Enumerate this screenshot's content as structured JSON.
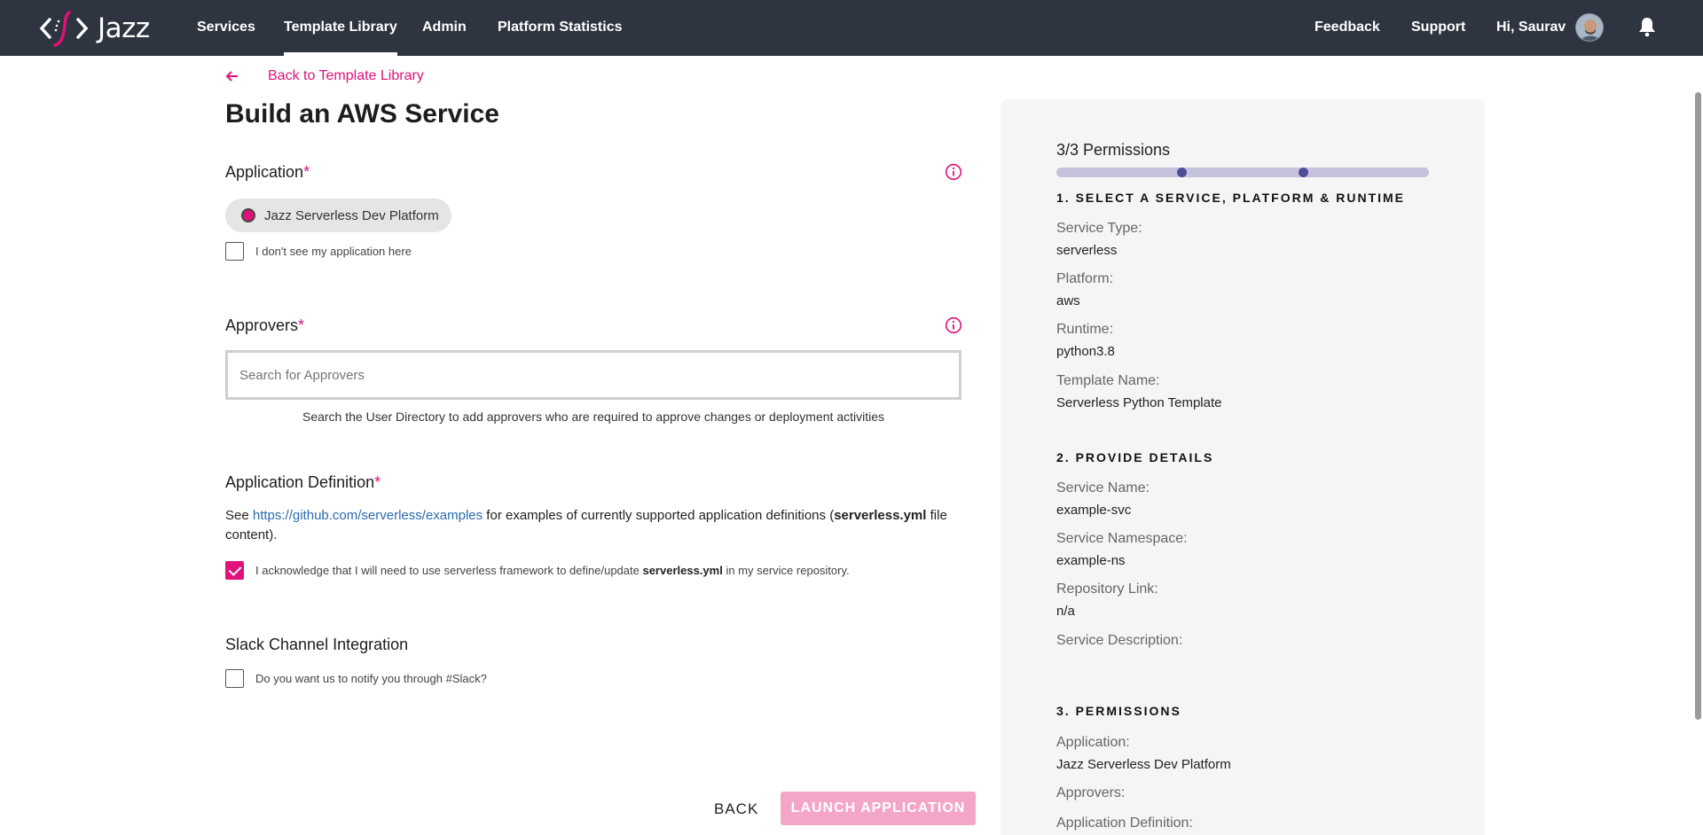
{
  "nav": {
    "brand": "Jazz",
    "items": [
      {
        "label": "Services"
      },
      {
        "label": "Template Library"
      },
      {
        "label": "Admin"
      },
      {
        "label": "Platform Statistics"
      }
    ],
    "feedback": "Feedback",
    "support": "Support",
    "greeting": "Hi, Saurav"
  },
  "page": {
    "back_link": "Back to Template Library",
    "title": "Build an AWS Service"
  },
  "application": {
    "label": "Application",
    "required": "*",
    "chip": "Jazz Serverless Dev Platform",
    "not_listed": "I don't see my application here"
  },
  "approvers": {
    "label": "Approvers",
    "required": "*",
    "placeholder": "Search for Approvers",
    "helper": "Search the User Directory to add approvers who are required to approve changes or deployment activities"
  },
  "definition": {
    "label": "Application Definition",
    "required": "*",
    "see": "See ",
    "link": "https://github.com/serverless/examples",
    "mid": " for examples of currently supported application definitions (",
    "file": "serverless.yml",
    "end": " file content).",
    "ack_pre": "I acknowledge that I will need to use serverless framework to define/update ",
    "ack_file": "serverless.yml",
    "ack_post": " in my service repository."
  },
  "slack": {
    "label": "Slack Channel Integration",
    "question": "Do you want us to notify you through #Slack?"
  },
  "actions": {
    "back": "BACK",
    "launch": "LAUNCH APPLICATION"
  },
  "summary": {
    "progress_label": "3/3 Permissions",
    "progress_fraction": 1.0,
    "step1": "1. SELECT A SERVICE, PLATFORM & RUNTIME",
    "service_type_label": "Service Type:",
    "service_type": "serverless",
    "platform_label": "Platform:",
    "platform": "aws",
    "runtime_label": "Runtime:",
    "runtime": "python3.8",
    "template_label": "Template Name:",
    "template": "Serverless Python Template",
    "step2": "2. PROVIDE DETAILS",
    "service_name_label": "Service Name:",
    "service_name": "example-svc",
    "namespace_label": "Service Namespace:",
    "namespace": "example-ns",
    "repo_label": "Repository Link:",
    "repo": "n/a",
    "description_label": "Service Description:",
    "step3": "3. PERMISSIONS",
    "app_label": "Application:",
    "app": "Jazz Serverless Dev Platform",
    "approvers_label": "Approvers:",
    "appdef_label": "Application Definition:"
  },
  "colors": {
    "accent": "#e0117a",
    "nav_bg": "#2e3440",
    "link": "#2b6cb0",
    "progress_track": "#c4c2dc",
    "progress_dot": "#4f4d99"
  }
}
